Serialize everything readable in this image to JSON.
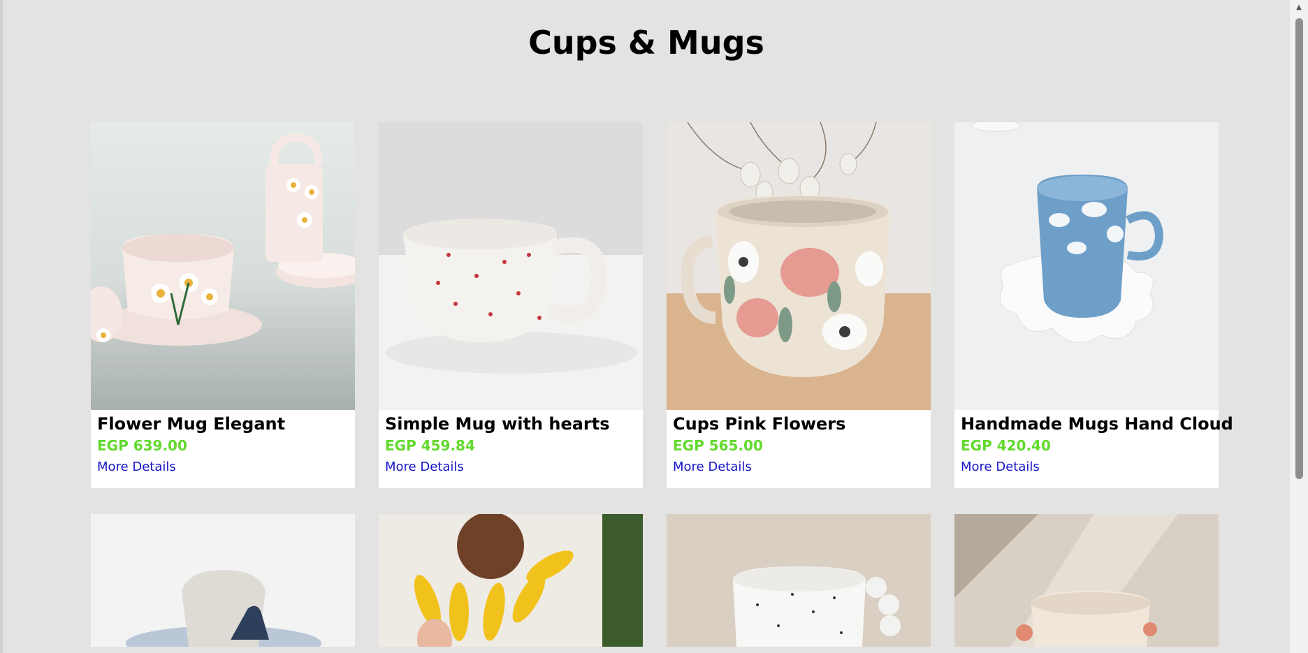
{
  "page": {
    "title": "Cups & Mugs"
  },
  "products": [
    {
      "name": "Flower Mug Elegant",
      "price": "EGP 639.00",
      "link": "More Details",
      "image": "flower-mug-photo"
    },
    {
      "name": "Simple Mug with hearts",
      "price": "EGP 459.84",
      "link": "More Details",
      "image": "hearts-mug-photo"
    },
    {
      "name": "Cups Pink Flowers",
      "price": "EGP 565.00",
      "link": "More Details",
      "image": "pink-flowers-cup-photo"
    },
    {
      "name": "Handmade Mugs Hand Cloud",
      "price": "EGP 420.40",
      "link": "More Details",
      "image": "cloud-mug-photo"
    }
  ],
  "products_row2": [
    {
      "image": "butterfly-cup-photo"
    },
    {
      "image": "sunflower-plate-photo"
    },
    {
      "image": "speckled-mug-photo"
    },
    {
      "image": "floral-mug-photo"
    }
  ],
  "colors": {
    "background": "#e3e3e2",
    "price": "#62d92c",
    "link": "#1515c8"
  }
}
